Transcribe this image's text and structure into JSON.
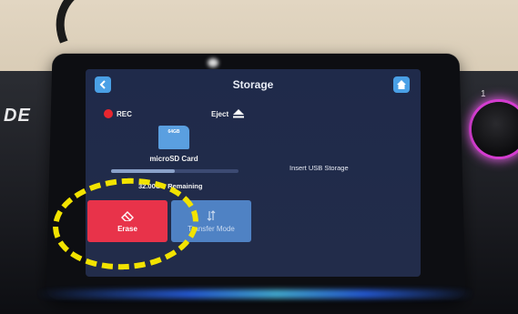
{
  "screen": {
    "title": "Storage",
    "back_icon": "chevron-left-icon",
    "home_icon": "home-icon",
    "rec_label": "REC",
    "eject_label": "Eject",
    "sd_card_badge": "64GB",
    "sd_card_label": "microSD Card",
    "remaining_text": "32.00GB Remaining",
    "usb_text": "Insert USB Storage",
    "storage_used_fraction": 0.5,
    "erase_label": "Erase",
    "transfer_label": "Transfer Mode"
  },
  "device": {
    "logo_text": "DE",
    "knob_label": "1"
  },
  "colors": {
    "screen_bg": "#1f2a4a",
    "accent_blue": "#4aa0e6",
    "erase_red": "#e8334a",
    "transfer_blue": "#4f82c4",
    "rec_red": "#e8262f",
    "annotation_yellow": "#f2e300"
  }
}
